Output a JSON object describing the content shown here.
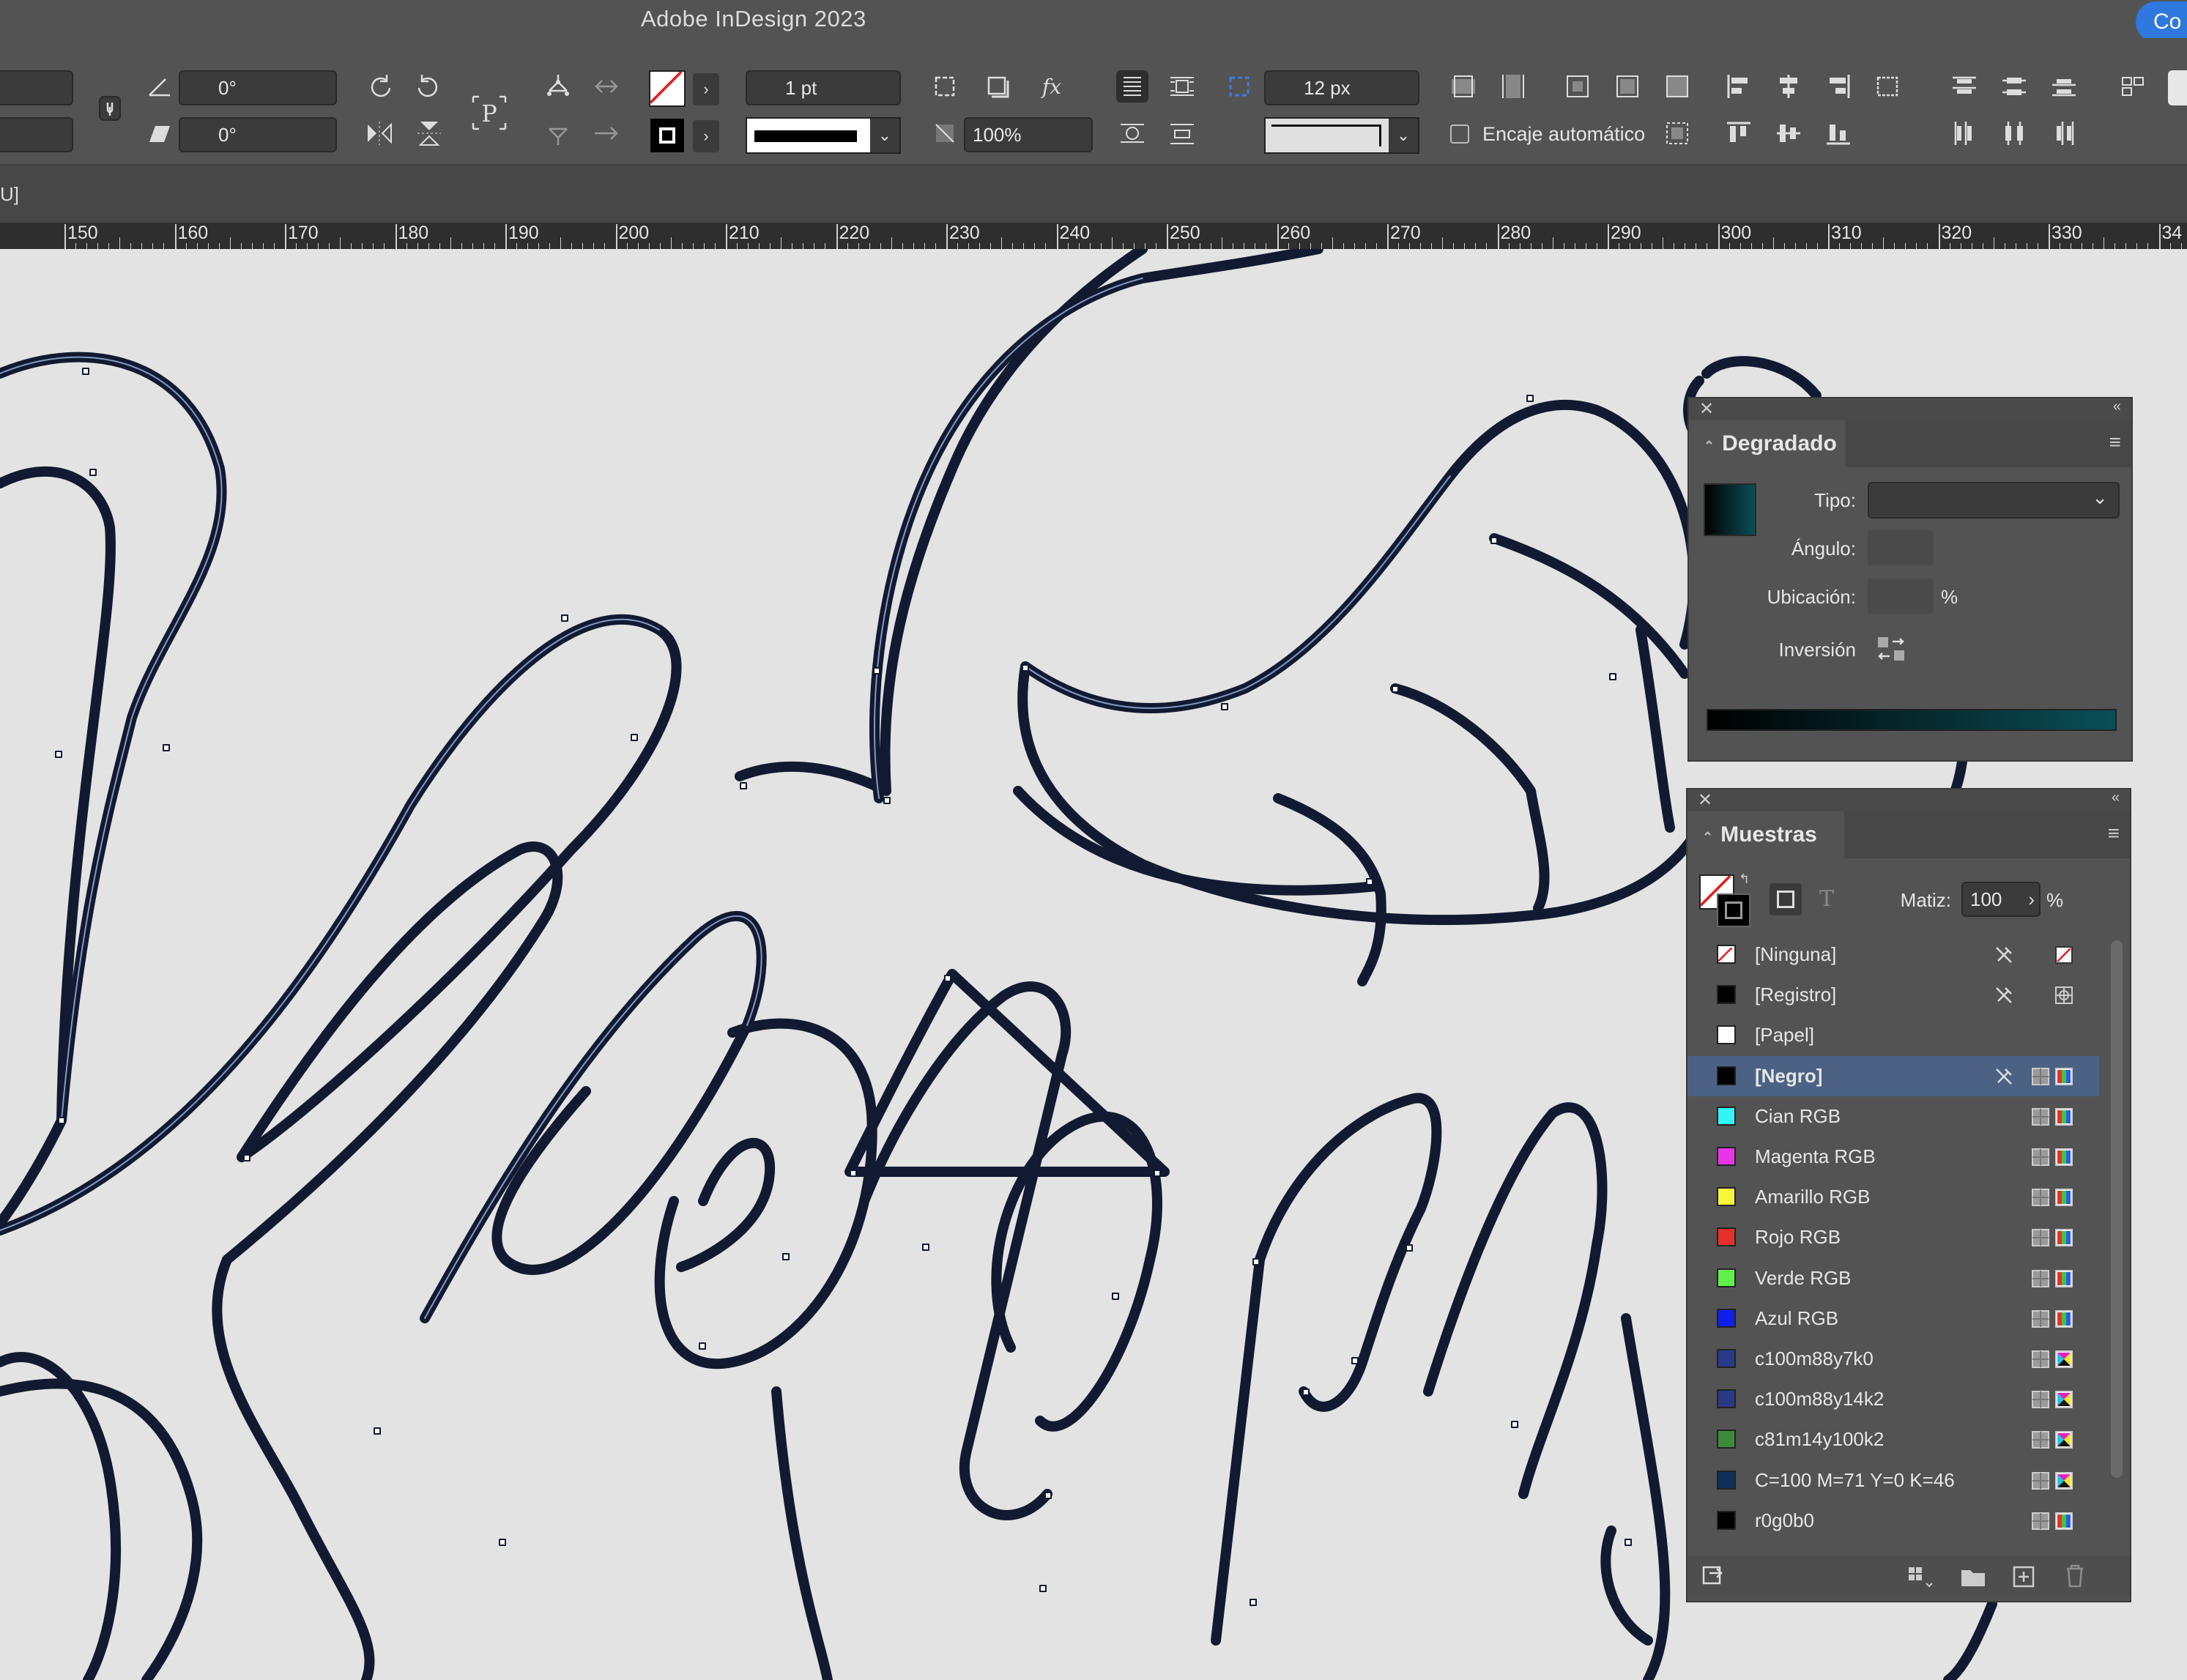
{
  "window": {
    "title": "Adobe InDesign 2023",
    "share_label": "Co"
  },
  "control_bar": {
    "rotate_angle": "0°",
    "shear_angle": "0°",
    "stroke_weight": "1 pt",
    "opacity": "100%",
    "corner_size": "12 px",
    "auto_fit_label": "Encaje automático"
  },
  "doc_tab": {
    "label": "U]"
  },
  "ruler": {
    "ticks": [
      "150",
      "160",
      "170",
      "180",
      "190",
      "200",
      "210",
      "220",
      "230",
      "240",
      "250",
      "260",
      "270",
      "280",
      "290",
      "300",
      "310",
      "320",
      "330",
      "34"
    ]
  },
  "gradient_panel": {
    "title": "Degradado",
    "type_label": "Tipo:",
    "angle_label": "Ángulo:",
    "location_label": "Ubicación:",
    "percent_sign": "%",
    "reverse_label": "Inversión",
    "gradient_colors": [
      "#000000",
      "#0b4f57"
    ]
  },
  "swatches_panel": {
    "title": "Muestras",
    "tint_label": "Matiz:",
    "tint_value": "100",
    "percent_sign": "%",
    "swatches": [
      {
        "name": "[Ninguna]",
        "color": "none"
      },
      {
        "name": "[Registro]",
        "color": "#000000"
      },
      {
        "name": "[Papel]",
        "color": "#ffffff"
      },
      {
        "name": "[Negro]",
        "color": "#000000"
      },
      {
        "name": "Cian RGB",
        "color": "#33f5f5"
      },
      {
        "name": "Magenta RGB",
        "color": "#ea34ea"
      },
      {
        "name": "Amarillo RGB",
        "color": "#f7f63a"
      },
      {
        "name": "Rojo RGB",
        "color": "#e8302b"
      },
      {
        "name": "Verde RGB",
        "color": "#5ff14a"
      },
      {
        "name": "Azul RGB",
        "color": "#0f1ff0"
      },
      {
        "name": "c100m88y7k0",
        "color": "#2a3a8a"
      },
      {
        "name": "c100m88y14k2",
        "color": "#2a3a82"
      },
      {
        "name": "c81m14y100k2",
        "color": "#3e8a3a"
      },
      {
        "name": "C=100 M=71 Y=0 K=46",
        "color": "#0f2f5a"
      },
      {
        "name": "r0g0b0",
        "color": "#000000"
      }
    ]
  }
}
